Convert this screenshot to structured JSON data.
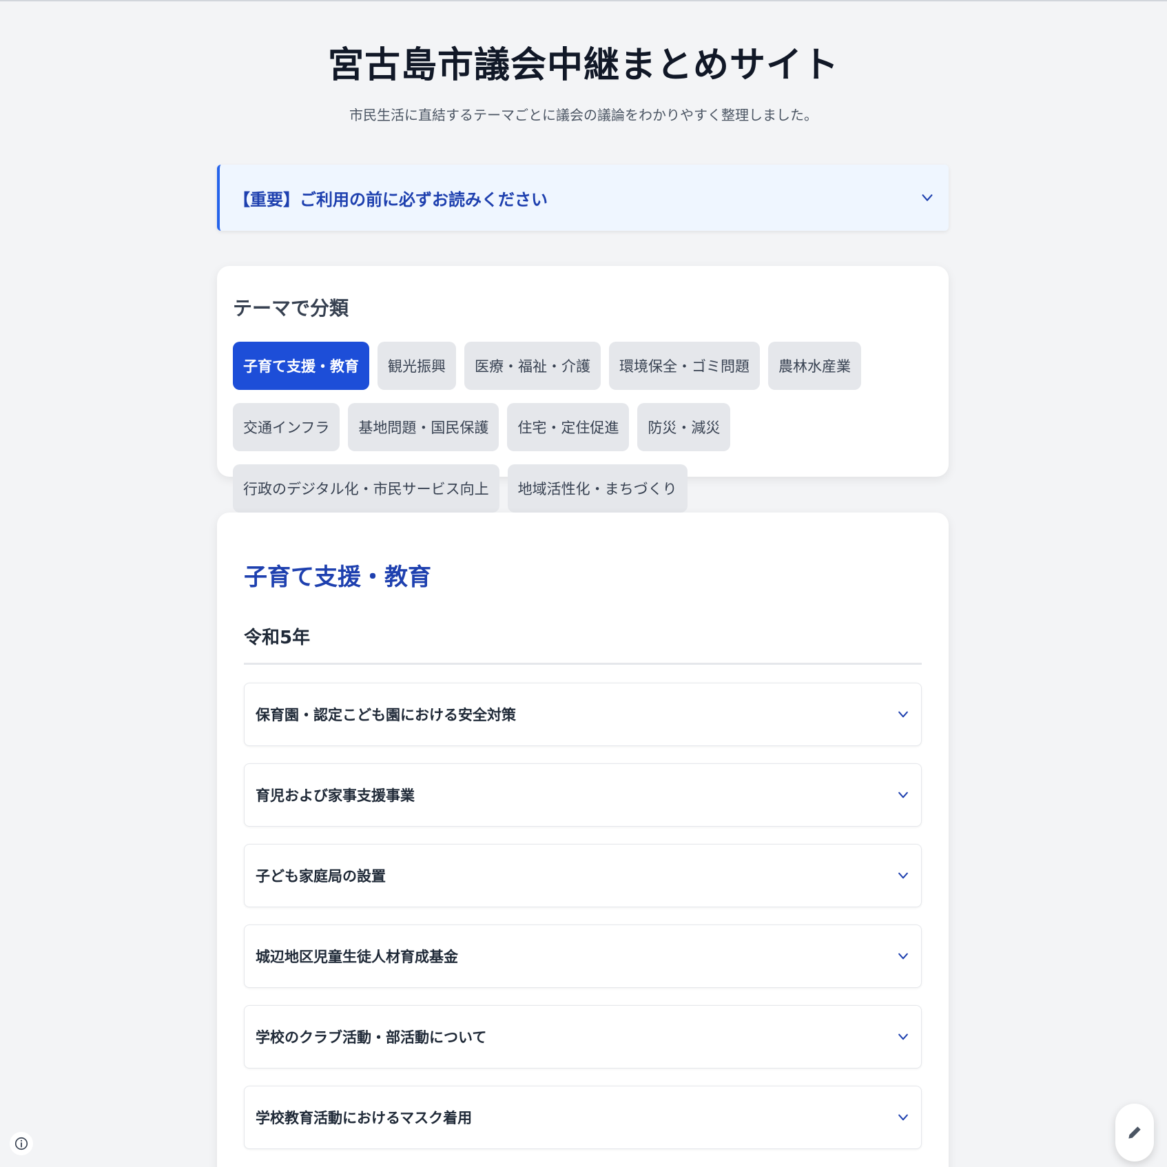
{
  "header": {
    "title": "宮古島市議会中継まとめサイト",
    "subtitle": "市民生活に直結するテーマごとに議会の議論をわかりやすく整理しました。"
  },
  "notice": {
    "label": "【重要】ご利用の前に必ずお読みください",
    "icon": "chevron-down-icon"
  },
  "themes": {
    "heading": "テーマで分類",
    "selected": "子育て支援・教育",
    "items": [
      "子育て支援・教育",
      "観光振興",
      "医療・福祉・介護",
      "環境保全・ゴミ問題",
      "農林水産業",
      "交通インフラ",
      "基地問題・国民保護",
      "住宅・定住促進",
      "防災・減災",
      "行政のデジタル化・市民サービス向上",
      "地域活性化・まちづくり"
    ]
  },
  "content": {
    "section_title": "子育て支援・教育",
    "year": "令和5年",
    "topics": [
      "保育園・認定こども園における安全対策",
      "育児および家事支援事業",
      "子ども家庭局の設置",
      "城辺地区児童生徒人材育成基金",
      "学校のクラブ活動・部活動について",
      "学校教育活動におけるマスク着用"
    ]
  },
  "colors": {
    "accent": "#1d4ed8",
    "accent_text": "#1e40af",
    "notice_bg": "#eff6ff",
    "page_bg": "#f3f4f6"
  },
  "floating": {
    "info_icon": "info-icon",
    "edit_icon": "pencil-icon"
  }
}
